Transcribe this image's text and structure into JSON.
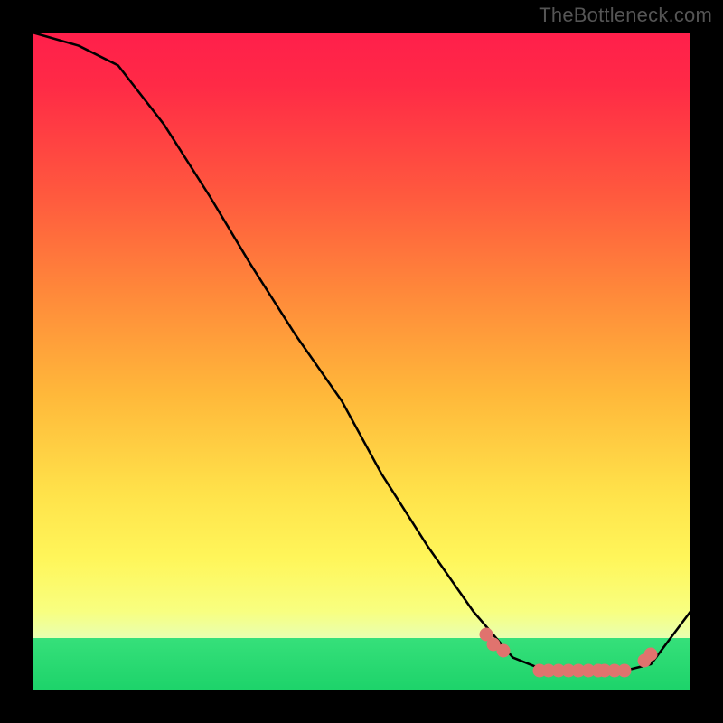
{
  "watermark": "TheBottleneck.com",
  "chart_data": {
    "type": "line",
    "title": "",
    "xlabel": "",
    "ylabel": "",
    "xlim": [
      0,
      100
    ],
    "ylim": [
      0,
      100
    ],
    "grid": false,
    "legend": false,
    "series": [
      {
        "name": "curve",
        "x": [
          0,
          7,
          13,
          20,
          27,
          33,
          40,
          47,
          53,
          60,
          67,
          73,
          78,
          82,
          86,
          90,
          94,
          97,
          100
        ],
        "values": [
          100,
          98,
          95,
          86,
          75,
          65,
          54,
          44,
          33,
          22,
          12,
          5,
          3,
          3,
          3,
          3,
          4,
          8,
          12
        ]
      },
      {
        "name": "threshold-dots",
        "x": [
          69,
          70,
          71.5,
          77,
          78.5,
          80,
          81.5,
          83,
          84.5,
          86,
          87,
          88.5,
          90,
          93,
          94
        ],
        "values": [
          8.5,
          7,
          6,
          3,
          3,
          3,
          3,
          3,
          3,
          3,
          3,
          3,
          3,
          4.5,
          5.5
        ]
      }
    ],
    "gradient_stops": {
      "top": "#ff1f4b",
      "mid": "#ffe24a",
      "bottom": "#1dd36a"
    }
  }
}
